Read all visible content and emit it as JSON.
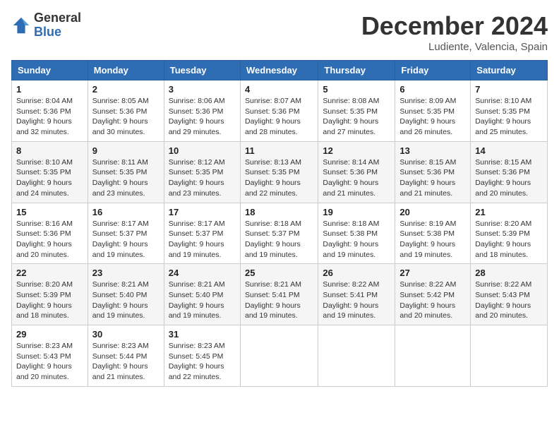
{
  "header": {
    "logo_general": "General",
    "logo_blue": "Blue",
    "title": "December 2024",
    "location": "Ludiente, Valencia, Spain"
  },
  "weekdays": [
    "Sunday",
    "Monday",
    "Tuesday",
    "Wednesday",
    "Thursday",
    "Friday",
    "Saturday"
  ],
  "weeks": [
    [
      {
        "day": "1",
        "sunrise": "Sunrise: 8:04 AM",
        "sunset": "Sunset: 5:36 PM",
        "daylight": "Daylight: 9 hours and 32 minutes."
      },
      {
        "day": "2",
        "sunrise": "Sunrise: 8:05 AM",
        "sunset": "Sunset: 5:36 PM",
        "daylight": "Daylight: 9 hours and 30 minutes."
      },
      {
        "day": "3",
        "sunrise": "Sunrise: 8:06 AM",
        "sunset": "Sunset: 5:36 PM",
        "daylight": "Daylight: 9 hours and 29 minutes."
      },
      {
        "day": "4",
        "sunrise": "Sunrise: 8:07 AM",
        "sunset": "Sunset: 5:36 PM",
        "daylight": "Daylight: 9 hours and 28 minutes."
      },
      {
        "day": "5",
        "sunrise": "Sunrise: 8:08 AM",
        "sunset": "Sunset: 5:35 PM",
        "daylight": "Daylight: 9 hours and 27 minutes."
      },
      {
        "day": "6",
        "sunrise": "Sunrise: 8:09 AM",
        "sunset": "Sunset: 5:35 PM",
        "daylight": "Daylight: 9 hours and 26 minutes."
      },
      {
        "day": "7",
        "sunrise": "Sunrise: 8:10 AM",
        "sunset": "Sunset: 5:35 PM",
        "daylight": "Daylight: 9 hours and 25 minutes."
      }
    ],
    [
      {
        "day": "8",
        "sunrise": "Sunrise: 8:10 AM",
        "sunset": "Sunset: 5:35 PM",
        "daylight": "Daylight: 9 hours and 24 minutes."
      },
      {
        "day": "9",
        "sunrise": "Sunrise: 8:11 AM",
        "sunset": "Sunset: 5:35 PM",
        "daylight": "Daylight: 9 hours and 23 minutes."
      },
      {
        "day": "10",
        "sunrise": "Sunrise: 8:12 AM",
        "sunset": "Sunset: 5:35 PM",
        "daylight": "Daylight: 9 hours and 23 minutes."
      },
      {
        "day": "11",
        "sunrise": "Sunrise: 8:13 AM",
        "sunset": "Sunset: 5:35 PM",
        "daylight": "Daylight: 9 hours and 22 minutes."
      },
      {
        "day": "12",
        "sunrise": "Sunrise: 8:14 AM",
        "sunset": "Sunset: 5:36 PM",
        "daylight": "Daylight: 9 hours and 21 minutes."
      },
      {
        "day": "13",
        "sunrise": "Sunrise: 8:15 AM",
        "sunset": "Sunset: 5:36 PM",
        "daylight": "Daylight: 9 hours and 21 minutes."
      },
      {
        "day": "14",
        "sunrise": "Sunrise: 8:15 AM",
        "sunset": "Sunset: 5:36 PM",
        "daylight": "Daylight: 9 hours and 20 minutes."
      }
    ],
    [
      {
        "day": "15",
        "sunrise": "Sunrise: 8:16 AM",
        "sunset": "Sunset: 5:36 PM",
        "daylight": "Daylight: 9 hours and 20 minutes."
      },
      {
        "day": "16",
        "sunrise": "Sunrise: 8:17 AM",
        "sunset": "Sunset: 5:37 PM",
        "daylight": "Daylight: 9 hours and 19 minutes."
      },
      {
        "day": "17",
        "sunrise": "Sunrise: 8:17 AM",
        "sunset": "Sunset: 5:37 PM",
        "daylight": "Daylight: 9 hours and 19 minutes."
      },
      {
        "day": "18",
        "sunrise": "Sunrise: 8:18 AM",
        "sunset": "Sunset: 5:37 PM",
        "daylight": "Daylight: 9 hours and 19 minutes."
      },
      {
        "day": "19",
        "sunrise": "Sunrise: 8:18 AM",
        "sunset": "Sunset: 5:38 PM",
        "daylight": "Daylight: 9 hours and 19 minutes."
      },
      {
        "day": "20",
        "sunrise": "Sunrise: 8:19 AM",
        "sunset": "Sunset: 5:38 PM",
        "daylight": "Daylight: 9 hours and 19 minutes."
      },
      {
        "day": "21",
        "sunrise": "Sunrise: 8:20 AM",
        "sunset": "Sunset: 5:39 PM",
        "daylight": "Daylight: 9 hours and 18 minutes."
      }
    ],
    [
      {
        "day": "22",
        "sunrise": "Sunrise: 8:20 AM",
        "sunset": "Sunset: 5:39 PM",
        "daylight": "Daylight: 9 hours and 18 minutes."
      },
      {
        "day": "23",
        "sunrise": "Sunrise: 8:21 AM",
        "sunset": "Sunset: 5:40 PM",
        "daylight": "Daylight: 9 hours and 19 minutes."
      },
      {
        "day": "24",
        "sunrise": "Sunrise: 8:21 AM",
        "sunset": "Sunset: 5:40 PM",
        "daylight": "Daylight: 9 hours and 19 minutes."
      },
      {
        "day": "25",
        "sunrise": "Sunrise: 8:21 AM",
        "sunset": "Sunset: 5:41 PM",
        "daylight": "Daylight: 9 hours and 19 minutes."
      },
      {
        "day": "26",
        "sunrise": "Sunrise: 8:22 AM",
        "sunset": "Sunset: 5:41 PM",
        "daylight": "Daylight: 9 hours and 19 minutes."
      },
      {
        "day": "27",
        "sunrise": "Sunrise: 8:22 AM",
        "sunset": "Sunset: 5:42 PM",
        "daylight": "Daylight: 9 hours and 20 minutes."
      },
      {
        "day": "28",
        "sunrise": "Sunrise: 8:22 AM",
        "sunset": "Sunset: 5:43 PM",
        "daylight": "Daylight: 9 hours and 20 minutes."
      }
    ],
    [
      {
        "day": "29",
        "sunrise": "Sunrise: 8:23 AM",
        "sunset": "Sunset: 5:43 PM",
        "daylight": "Daylight: 9 hours and 20 minutes."
      },
      {
        "day": "30",
        "sunrise": "Sunrise: 8:23 AM",
        "sunset": "Sunset: 5:44 PM",
        "daylight": "Daylight: 9 hours and 21 minutes."
      },
      {
        "day": "31",
        "sunrise": "Sunrise: 8:23 AM",
        "sunset": "Sunset: 5:45 PM",
        "daylight": "Daylight: 9 hours and 22 minutes."
      },
      null,
      null,
      null,
      null
    ]
  ]
}
